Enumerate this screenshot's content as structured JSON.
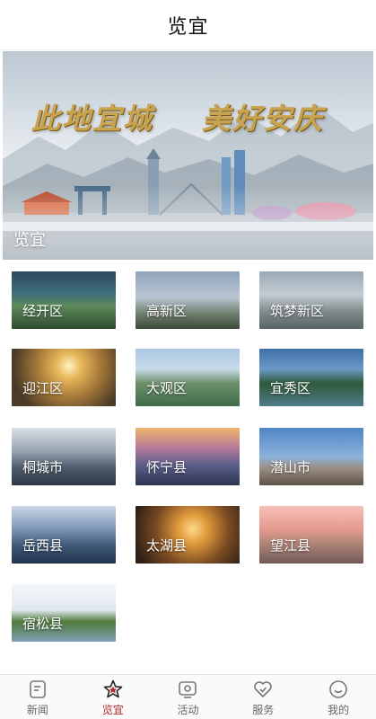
{
  "header": {
    "title": "览宜"
  },
  "banner": {
    "slogan_left": "此地宜城",
    "slogan_right": "美好安庆",
    "label": "览宜"
  },
  "districts": [
    {
      "name": "经开区",
      "scene": "park"
    },
    {
      "name": "高新区",
      "scene": "towers"
    },
    {
      "name": "筑梦新区",
      "scene": "campus"
    },
    {
      "name": "迎江区",
      "scene": "sunset-river"
    },
    {
      "name": "大观区",
      "scene": "lake-city"
    },
    {
      "name": "宜秀区",
      "scene": "lake-forest"
    },
    {
      "name": "桐城市",
      "scene": "misty-mountains"
    },
    {
      "name": "怀宁县",
      "scene": "dusk-lake"
    },
    {
      "name": "潜山市",
      "scene": "rock-peak"
    },
    {
      "name": "岳西县",
      "scene": "blue-ridges"
    },
    {
      "name": "太湖县",
      "scene": "golden-lake"
    },
    {
      "name": "望江县",
      "scene": "pink-sunset"
    },
    {
      "name": "宿松县",
      "scene": "island-rock"
    }
  ],
  "tabbar": {
    "items": [
      {
        "label": "新闻",
        "icon": "news-icon",
        "active": false
      },
      {
        "label": "览宜",
        "icon": "star-icon",
        "active": true
      },
      {
        "label": "活动",
        "icon": "activity-icon",
        "active": false
      },
      {
        "label": "服务",
        "icon": "heart-service-icon",
        "active": false
      },
      {
        "label": "我的",
        "icon": "smile-profile-icon",
        "active": false
      }
    ]
  },
  "colors": {
    "accent": "#b0262a",
    "gold": "#c9a450"
  }
}
